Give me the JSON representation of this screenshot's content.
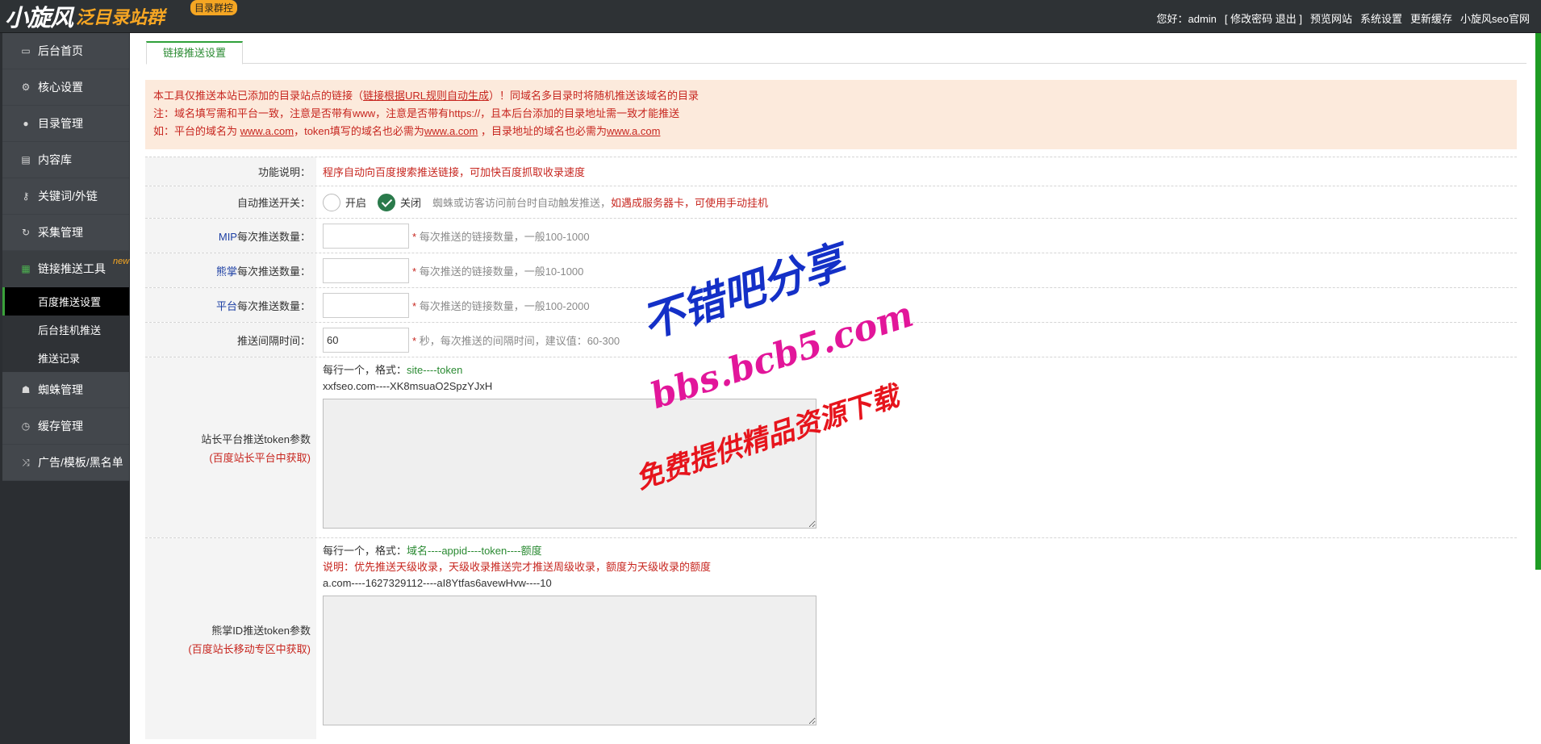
{
  "header": {
    "logo_main": "小旋风",
    "logo_sub": "泛目录站群",
    "logo_badge": "目录群控",
    "nav": [
      "您好：admin",
      "[ 修改密码 退出 ]",
      "预览网站",
      "系统设置",
      "更新缓存",
      "小旋风seo官网"
    ]
  },
  "sidebar": {
    "items": [
      {
        "label": "后台首页",
        "icon": "monitor-icon"
      },
      {
        "label": "核心设置",
        "icon": "gear-icon"
      },
      {
        "label": "目录管理",
        "icon": "user-icon"
      },
      {
        "label": "内容库",
        "icon": "document-icon"
      },
      {
        "label": "关键词/外链",
        "icon": "key-icon"
      },
      {
        "label": "采集管理",
        "icon": "refresh-icon"
      },
      {
        "label": "链接推送工具",
        "icon": "grid-icon",
        "badge": "new"
      }
    ],
    "subitems": [
      "百度推送设置",
      "后台挂机推送",
      "推送记录"
    ],
    "items_after": [
      {
        "label": "蜘蛛管理",
        "icon": "android-icon"
      },
      {
        "label": "缓存管理",
        "icon": "timer-icon"
      },
      {
        "label": "广告/模板/黑名单",
        "icon": "shuffle-icon"
      }
    ]
  },
  "tab": {
    "label": "链接推送设置"
  },
  "notice": {
    "line1_a": "本工具仅推送本站已添加的目录站点的链接（",
    "line1_link": "链接根据URL规则自动生成",
    "line1_b": "）！同域名多目录时将随机推送该域名的目录",
    "line2": "注：域名填写需和平台一致，注意是否带有www，注意是否带有https://，且本后台添加的目录地址需一致才能推送",
    "line3_a": "如：平台的域名为 ",
    "line3_link1": "www.a.com",
    "line3_b": "，token填写的域名也必需为",
    "line3_link2": "www.a.com",
    "line3_c": " ，目录地址的域名也必需为",
    "line3_link3": "www.a.com"
  },
  "form": {
    "func_label": "功能说明：",
    "func_text": "程序自动向百度搜索推送链接，可加快百度抓取收录速度",
    "auto_label": "自动推送开关：",
    "auto_on": "开启",
    "auto_off": "关闭",
    "auto_selected": "关闭",
    "auto_hint_a": "蜘蛛或访客访问前台时自动触发推送，",
    "auto_hint_b": "如遇成服务器卡，可使用手动挂机",
    "mip_label_a": "MIP",
    "mip_label_b": "每次推送数量：",
    "mip_value": "",
    "mip_hint": "每次推送的链接数量，一般100-1000",
    "xz_label_a": "熊掌",
    "xz_label_b": "每次推送数量：",
    "xz_value": "",
    "xz_hint": "每次推送的链接数量，一般10-1000",
    "pt_label_a": "平台",
    "pt_label_b": "每次推送数量：",
    "pt_value": "",
    "pt_hint": "每次推送的链接数量，一般100-2000",
    "interval_label": "推送间隔时间：",
    "interval_value": "60",
    "interval_hint": "秒，每次推送的间隔时间，建议值：60-300",
    "star": "*",
    "token_label": "站长平台推送token参数",
    "token_sub": "(百度站长平台中获取)",
    "token_format_a": "每行一个，格式：",
    "token_format_b": "site----token",
    "token_example": "xxfseo.com----XK8msuaO2SpzYJxH",
    "xzid_label": "熊掌ID推送token参数",
    "xzid_sub": "(百度站长移动专区中获取)",
    "xzid_format_a": "每行一个，格式：",
    "xzid_format_b": "域名----appid----token----额度",
    "xzid_note": "说明：优先推送天级收录，天级收录推送完才推送周级收录，额度为天级收录的额度",
    "xzid_example": "a.com----1627329112----aI8Ytfas6avewHvw----10"
  },
  "watermark": {
    "line1": "不错吧分享",
    "line2": "bbs.bcb5.com",
    "line3": "免费提供精品资源下载"
  }
}
